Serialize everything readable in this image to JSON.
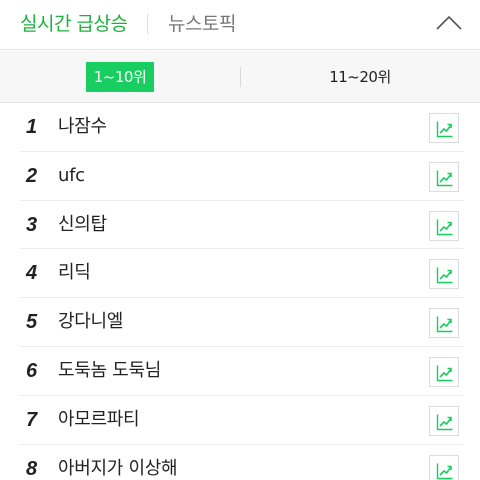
{
  "header": {
    "title": "실시간 급상승",
    "news_tab": "뉴스토픽",
    "collapse_icon": "chevron-up-icon"
  },
  "range_tabs": {
    "active": "1~10위",
    "inactive": "11~20위"
  },
  "items": [
    {
      "rank": "1",
      "term": "나잠수"
    },
    {
      "rank": "2",
      "term": "ufc"
    },
    {
      "rank": "3",
      "term": "신의탑"
    },
    {
      "rank": "4",
      "term": "리딕"
    },
    {
      "rank": "5",
      "term": "강다니엘"
    },
    {
      "rank": "6",
      "term": "도둑놈 도둑님"
    },
    {
      "rank": "7",
      "term": "아모르파티"
    },
    {
      "rank": "8",
      "term": "아버지가 이상해"
    }
  ],
  "trend_icon": "trend-chart-icon",
  "colors": {
    "accent": "#1db33b",
    "active_tab_bg": "#19ce60",
    "text": "#222222",
    "muted": "#777777"
  }
}
